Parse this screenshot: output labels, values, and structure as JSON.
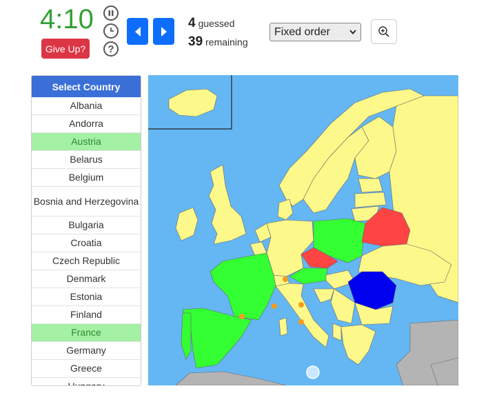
{
  "timer": "4:10",
  "give_up_label": "Give Up?",
  "stats": {
    "guessed_count": "4",
    "guessed_label": "guessed",
    "remaining_count": "39",
    "remaining_label": "remaining"
  },
  "order_select": {
    "selected": "Fixed order"
  },
  "panel": {
    "title": "Select Country",
    "countries": [
      {
        "name": "Albania",
        "guessed": false
      },
      {
        "name": "Andorra",
        "guessed": false
      },
      {
        "name": "Austria",
        "guessed": true
      },
      {
        "name": "Belarus",
        "guessed": false
      },
      {
        "name": "Belgium",
        "guessed": false
      },
      {
        "name": "Bosnia and Herzegovina",
        "guessed": false
      },
      {
        "name": "Bulgaria",
        "guessed": false
      },
      {
        "name": "Croatia",
        "guessed": false
      },
      {
        "name": "Czech Republic",
        "guessed": false
      },
      {
        "name": "Denmark",
        "guessed": false
      },
      {
        "name": "Estonia",
        "guessed": false
      },
      {
        "name": "Finland",
        "guessed": false
      },
      {
        "name": "France",
        "guessed": true
      },
      {
        "name": "Germany",
        "guessed": false
      },
      {
        "name": "Greece",
        "guessed": false
      },
      {
        "name": "Hungary",
        "guessed": false
      }
    ]
  },
  "icons": {
    "pause": "pause-icon",
    "clock": "clock-icon",
    "help": "help-icon",
    "prev": "chevron-left-icon",
    "next": "chevron-right-icon",
    "zoom": "zoom-in-icon",
    "select": "chevron-down-icon"
  },
  "map_colors": {
    "sea": "#64b7f3",
    "land": "#fdf88a",
    "correct": "#33ff33",
    "wrong": "#ff4444",
    "selected": "#0000ee",
    "outside": "#b4b4b4",
    "microstate": "#f39c1c"
  },
  "accent_colors": {
    "timer": "#33a033",
    "give_up": "#dc3545",
    "nav": "#0d6efd",
    "panel_header": "#3b6fd8"
  }
}
